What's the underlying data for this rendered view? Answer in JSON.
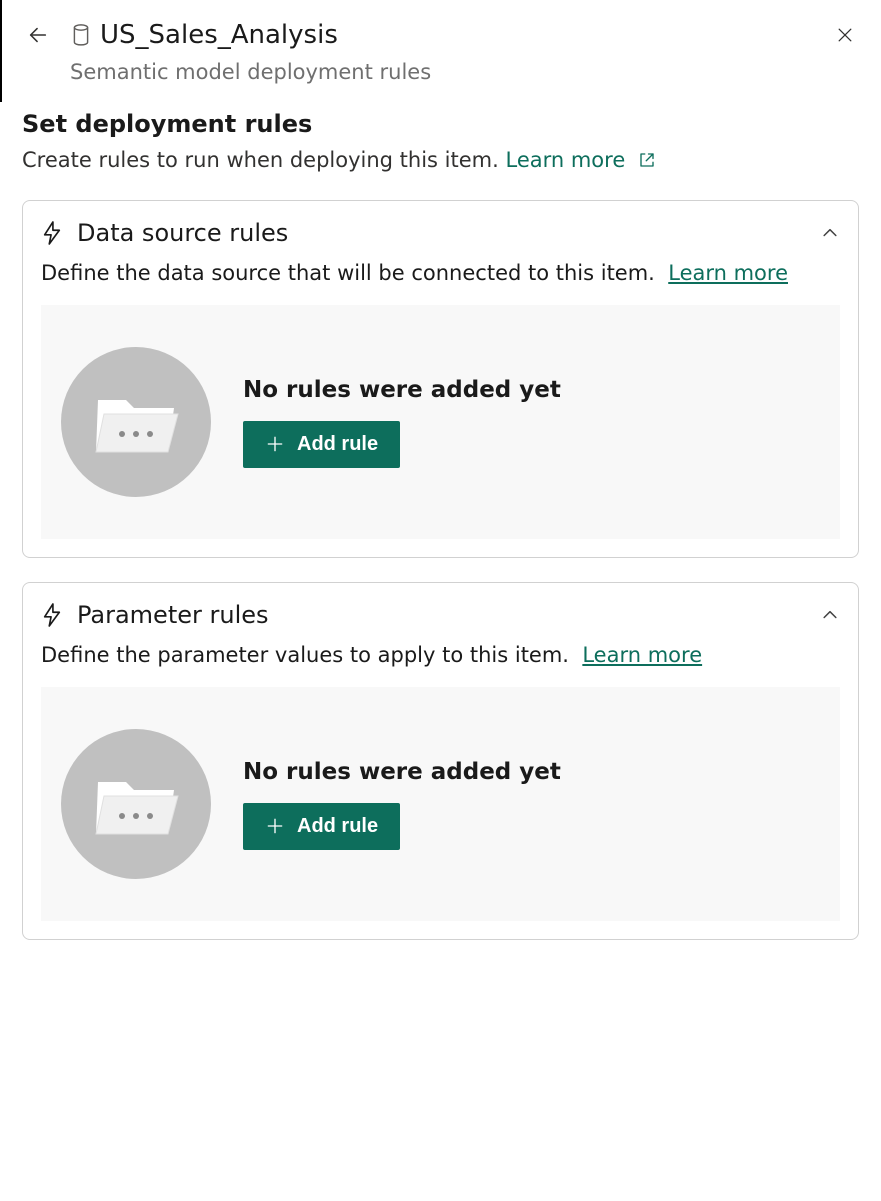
{
  "header": {
    "title": "US_Sales_Analysis",
    "subtitle": "Semantic model deployment rules"
  },
  "section": {
    "title": "Set deployment rules",
    "description": "Create rules to run when deploying this item.",
    "learn_more": "Learn more"
  },
  "cards": {
    "data_source": {
      "title": "Data source rules",
      "description": "Define the data source that will be connected to this item.",
      "learn_more": "Learn more",
      "empty_message": "No rules were added yet",
      "add_label": "Add rule"
    },
    "parameter": {
      "title": "Parameter rules",
      "description": "Define the parameter values to apply to this item.",
      "learn_more": "Learn more",
      "empty_message": "No rules were added yet",
      "add_label": "Add rule"
    }
  }
}
